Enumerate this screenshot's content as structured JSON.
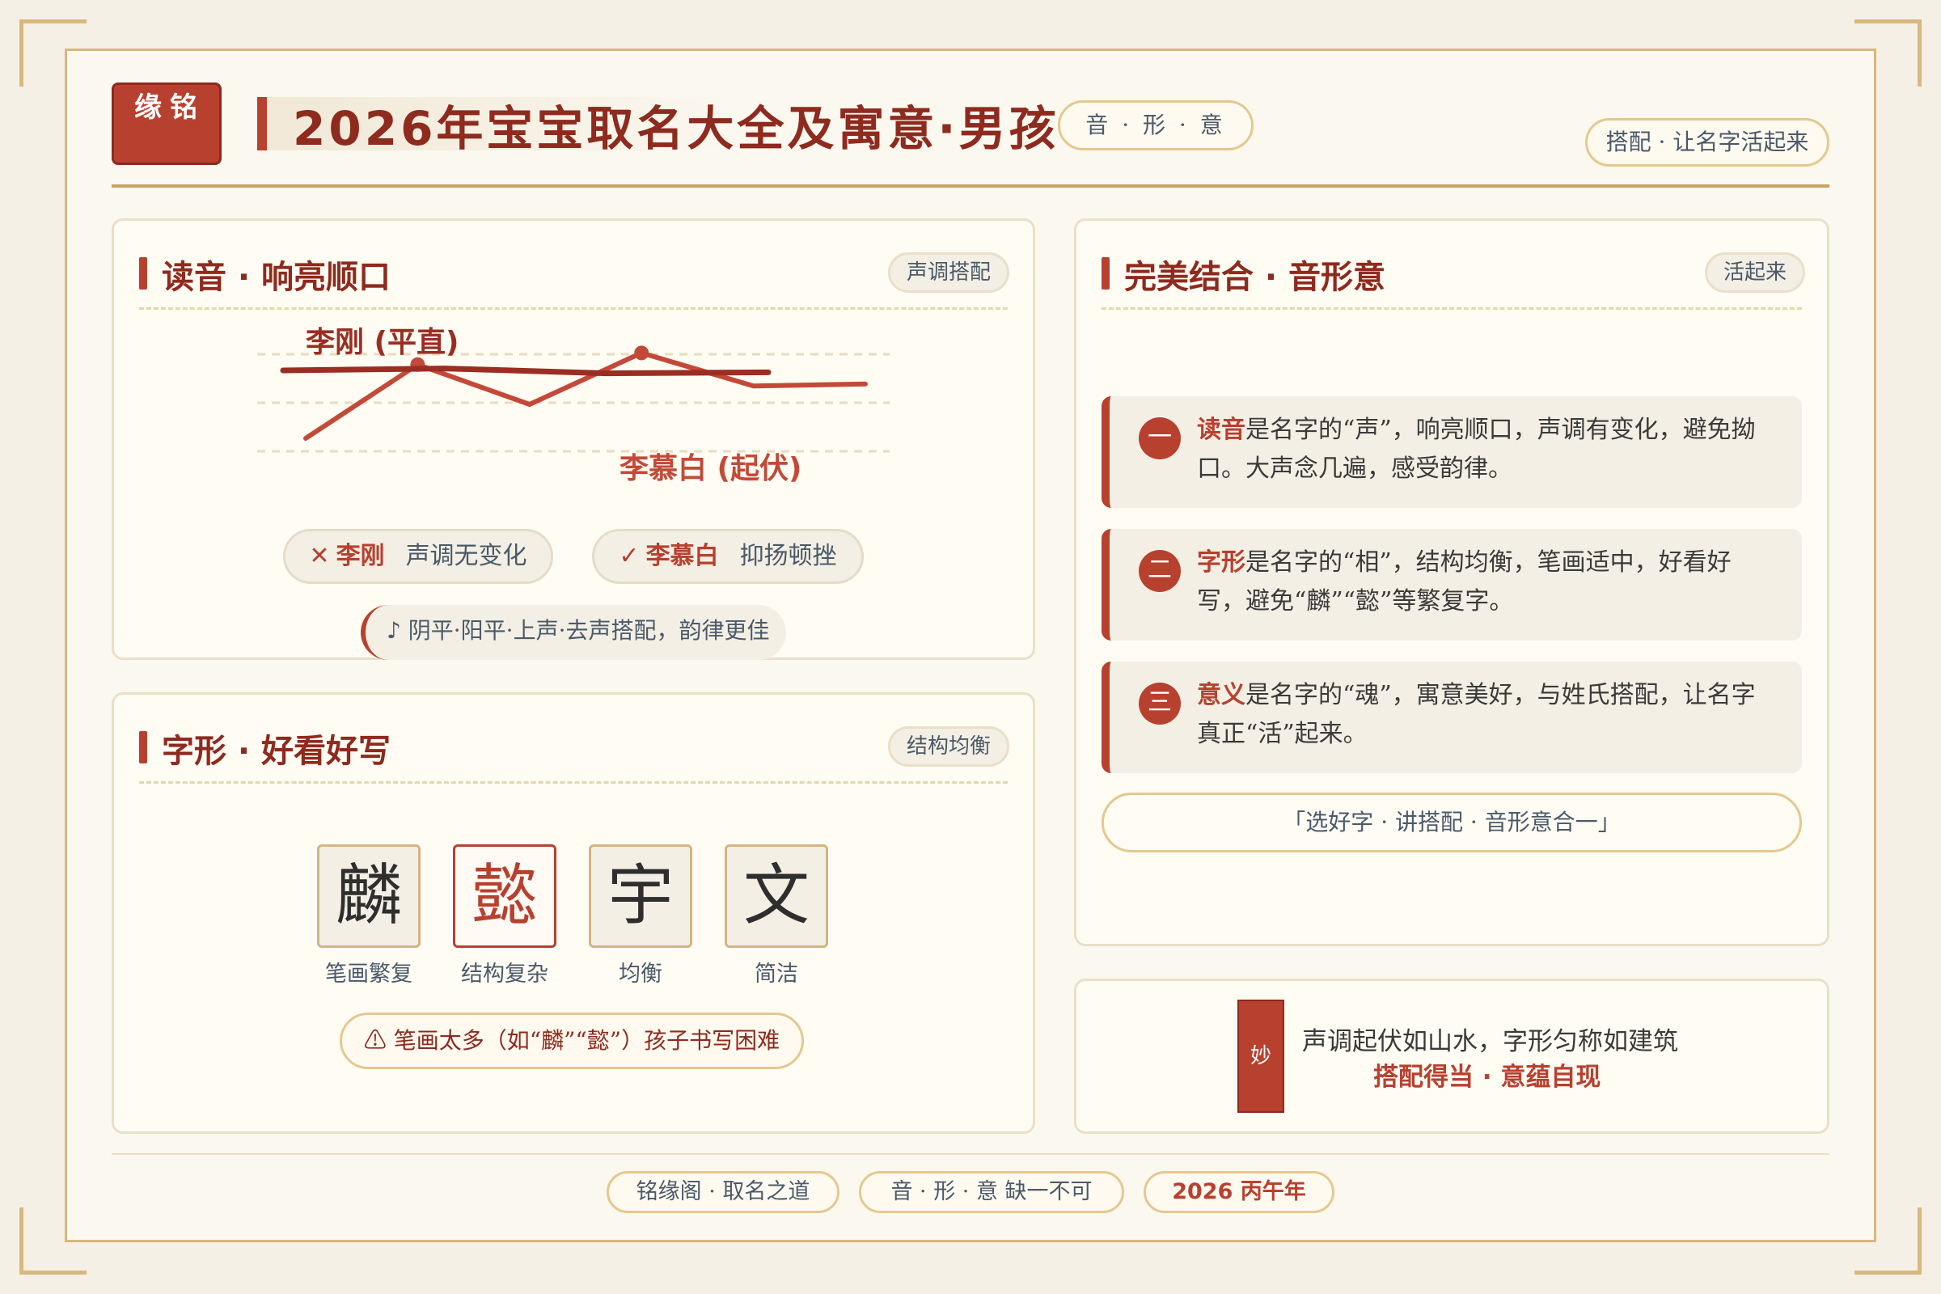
{
  "header": {
    "seal": "缘铭",
    "title": "2026年宝宝取名大全及寓意·男孩",
    "pill": "音 · 形 · 意",
    "right_pill": "搭配 · 让名字活起来"
  },
  "pronunciation": {
    "title": "读音 · 响亮顺口",
    "tag": "声调搭配",
    "flat_label": "李刚 (平直)",
    "wavy_label": "李慕白 (起伏)",
    "bad": {
      "mark": "✕",
      "name": "李刚",
      "desc": "声调无变化"
    },
    "good": {
      "mark": "✓",
      "name": "李慕白",
      "desc": "抑扬顿挫"
    },
    "rhythm_note": "♪ 阴平·阳平·上声·去声搭配，韵律更佳"
  },
  "shape": {
    "title": "字形 · 好看好写",
    "tag": "结构均衡",
    "glyphs": [
      {
        "char": "麟",
        "caption": "笔画繁复"
      },
      {
        "char": "懿",
        "caption": "结构复杂"
      },
      {
        "char": "宇",
        "caption": "均衡"
      },
      {
        "char": "文",
        "caption": "简洁"
      }
    ],
    "warning": "⚠ 笔画太多（如“麟”“懿”）孩子书写困难"
  },
  "combination": {
    "title": "完美结合 · 音形意",
    "tag": "活起来",
    "items": [
      {
        "num": "一",
        "kw": "读音",
        "text": "是名字的“声”，响亮顺口，声调有变化，避免拗口。大声念几遍，感受韵律。"
      },
      {
        "num": "二",
        "kw": "字形",
        "text": "是名字的“相”，结构均衡，笔画适中，好看好写，避免“麟”“懿”等繁复字。"
      },
      {
        "num": "三",
        "kw": "意义",
        "text": "是名字的“魂”，寓意美好，与姓氏搭配，让名字真正“活”起来。"
      }
    ],
    "motto": "「选好字 · 讲搭配 · 音形意合一」"
  },
  "summary": {
    "seal": "妙",
    "line1": "声调起伏如山水，字形匀称如建筑",
    "line2": "搭配得当 · 意蕴自现"
  },
  "footer": {
    "items": [
      "铭缘阁 · 取名之道",
      "音 · 形 · 意 缺一不可",
      "2026 丙午年"
    ]
  },
  "chart_data": {
    "type": "line",
    "series": [
      {
        "name": "李刚 (平直)",
        "values": [
          0.3,
          0.26,
          0.36,
          0.34
        ]
      },
      {
        "name": "李慕白 (起伏)",
        "values": [
          1.7,
          0.18,
          1.0,
          -0.06,
          0.62,
          0.58
        ]
      }
    ],
    "colors": {
      "flat": "#9a2e22",
      "wavy": "#c34a38"
    }
  }
}
